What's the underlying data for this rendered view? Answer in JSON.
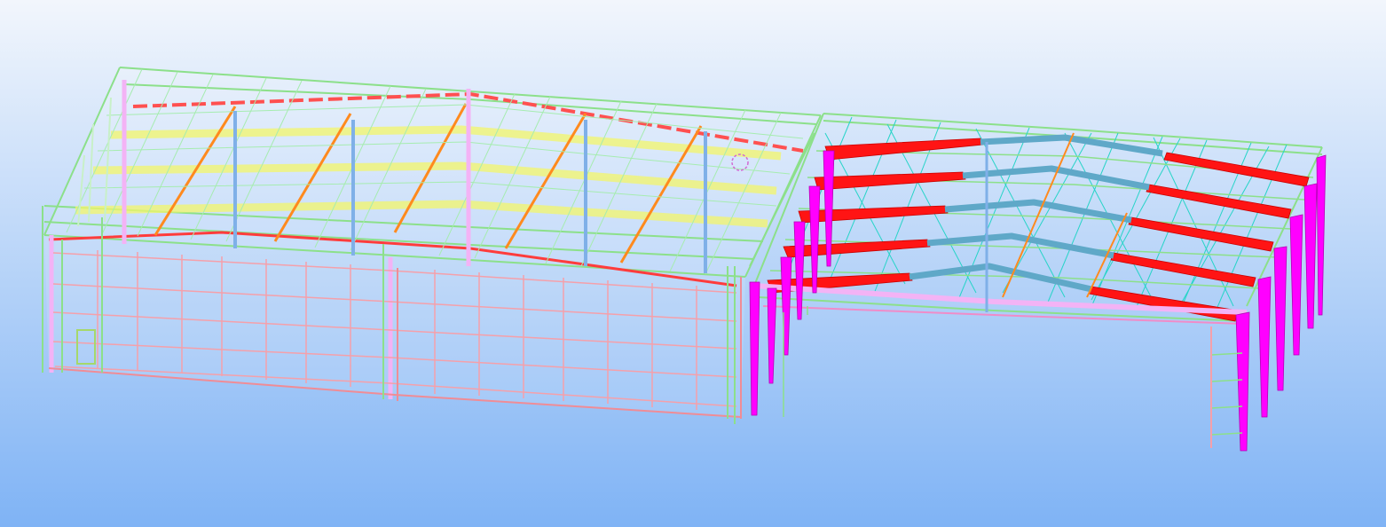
{
  "viewport": {
    "background_top": "#f2f6fc",
    "background_bottom": "#7fb3f5",
    "colors": {
      "column": "#ff00ff",
      "rafter_red": "#ff1414",
      "rafter_blue": "#5fa8c8",
      "purlin_yellow": "#f3f56a",
      "purlin_green": "#8ce08a",
      "bracing_cyan": "#27d4c8",
      "wall_pink": "#f5a0aa",
      "eave_orange": "#ff8a1e",
      "light_column": "#f3b3f5",
      "steel_blue": "#7fb0e8"
    }
  }
}
